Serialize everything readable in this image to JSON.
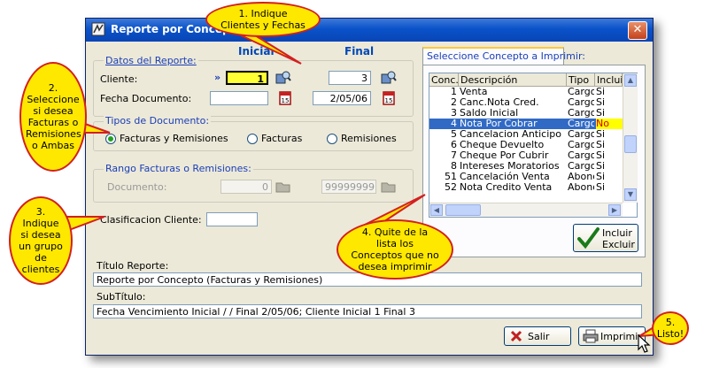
{
  "window": {
    "title": "Reporte por Concepto",
    "close_glyph": "✕"
  },
  "headers": {
    "inicial": "Inicial",
    "final": "Final"
  },
  "datos": {
    "group_label": "Datos del Reporte:",
    "cliente_label": "Cliente:",
    "cliente_marker": "»",
    "cliente_inicial": "1",
    "cliente_final": "3",
    "fecha_label": "Fecha Documento:",
    "fecha_inicial": "",
    "fecha_final": "2/05/06"
  },
  "tipos": {
    "group_label": "Tipos de Documento:",
    "options": [
      "Facturas y Remisiones",
      "Facturas",
      "Remisiones"
    ],
    "selected": "Facturas y Remisiones"
  },
  "rango": {
    "group_label": "Rango Facturas o Remisiones:",
    "documento_label": "Documento:",
    "inicial": "0",
    "final": "99999999"
  },
  "clasificacion": {
    "label": "Clasificacion Cliente:",
    "value": ""
  },
  "tab": {
    "label": "Seleccione Concepto a Imprimir:"
  },
  "table": {
    "columns": [
      "Conc.",
      "Descripción",
      "Tipo",
      "Incluir"
    ],
    "rows": [
      {
        "conc": "1",
        "desc": "Venta",
        "tipo": "Cargo",
        "incluir": "Si"
      },
      {
        "conc": "2",
        "desc": "Canc.Nota Cred.",
        "tipo": "Cargo",
        "incluir": "Si"
      },
      {
        "conc": "3",
        "desc": "Saldo Inicial",
        "tipo": "Cargo",
        "incluir": "Si"
      },
      {
        "conc": "4",
        "desc": "Nota Por Cobrar",
        "tipo": "Cargo",
        "incluir": "No"
      },
      {
        "conc": "5",
        "desc": "Cancelacion Anticipo",
        "tipo": "Cargo",
        "incluir": "Si"
      },
      {
        "conc": "6",
        "desc": "Cheque Devuelto",
        "tipo": "Cargo",
        "incluir": "Si"
      },
      {
        "conc": "7",
        "desc": "Cheque Por Cubrir",
        "tipo": "Cargo",
        "incluir": "Si"
      },
      {
        "conc": "8",
        "desc": "Intereses Moratorios",
        "tipo": "Cargo",
        "incluir": "Si"
      },
      {
        "conc": "51",
        "desc": "Cancelación Venta",
        "tipo": "Abono",
        "incluir": "Si"
      },
      {
        "conc": "52",
        "desc": "Nota Credito Venta",
        "tipo": "Abono",
        "incluir": "Si"
      }
    ],
    "selected_index": 3
  },
  "incluir_button": {
    "line1": "Incluir",
    "line2": "Excluir"
  },
  "titulo": {
    "label": "Título Reporte:",
    "value": "Reporte por Concepto (Facturas y Remisiones)"
  },
  "subtitulo": {
    "label": "SubTítulo:",
    "value": "Fecha Vencimiento Inicial  /  / Final  2/05/06;  Cliente Inicial 1 Final 3"
  },
  "buttons": {
    "salir": "Salir",
    "imprimir": "Imprimir"
  },
  "callouts": {
    "c1": "1. Indique Clientes y Fechas",
    "c2": "2. Seleccione si desea Facturas o Remisiones o Ambas",
    "c3": "3. Indique si desea un grupo de clientes",
    "c4": "4. Quite de la lista los Conceptos que no desea imprimir",
    "c5": "5. Listo!"
  },
  "colors": {
    "callout_fill": "#ffe800",
    "callout_border": "#d32020",
    "selection": "#316ac5",
    "titlebar": "#0a52c9"
  }
}
